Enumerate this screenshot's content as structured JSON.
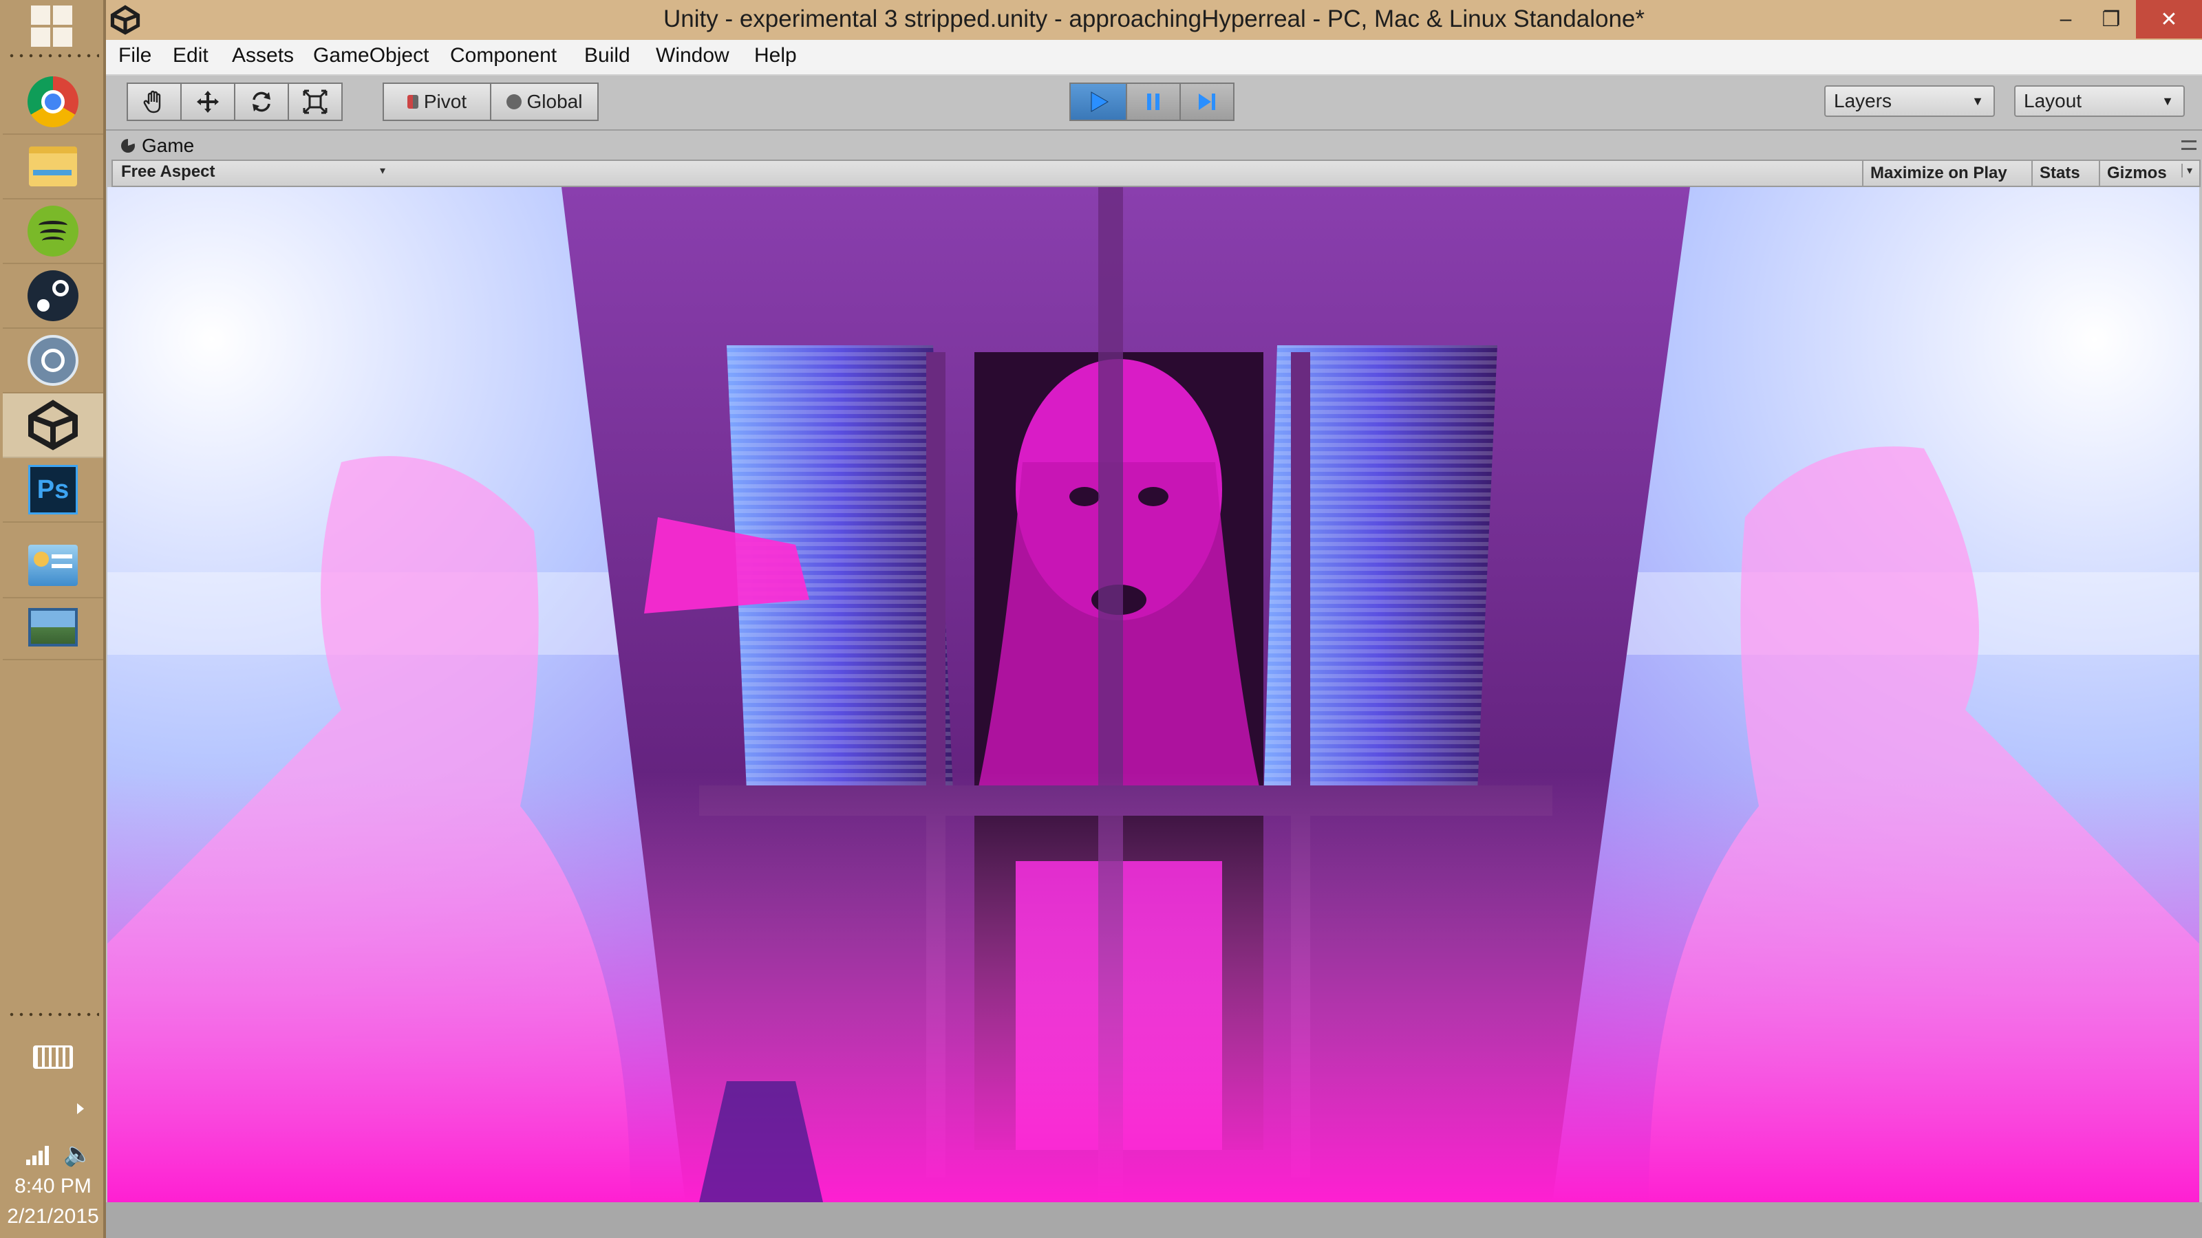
{
  "window": {
    "title": "Unity - experimental 3 stripped.unity - approachingHyperreal - PC, Mac & Linux Standalone*",
    "controls": {
      "minimize": "–",
      "restore": "❐",
      "close": "✕"
    }
  },
  "menu": {
    "items": [
      "File",
      "Edit",
      "Assets",
      "GameObject",
      "Component",
      "Build",
      "Window",
      "Help"
    ]
  },
  "toolbar": {
    "pivot_label": "Pivot",
    "global_label": "Global",
    "layers_label": "Layers",
    "layout_label": "Layout"
  },
  "game_panel": {
    "tab_label": "Game",
    "aspect_label": "Free Aspect",
    "maximize_label": "Maximize on Play",
    "stats_label": "Stats",
    "gizmos_label": "Gizmos"
  },
  "taskbar": {
    "apps": [
      {
        "icon": "chrome-icon"
      },
      {
        "icon": "file-explorer-icon"
      },
      {
        "icon": "spotify-icon"
      },
      {
        "icon": "steam-icon"
      },
      {
        "icon": "monodevelop-icon"
      },
      {
        "icon": "unity-icon"
      },
      {
        "icon": "photoshop-icon",
        "label": "Ps"
      },
      {
        "icon": "control-panel-icon"
      },
      {
        "icon": "photo-viewer-icon"
      }
    ],
    "time": "8:40 PM",
    "date": "2/21/2015"
  },
  "colors": {
    "taskbar_bg": "#b89a6e",
    "titlebar_bg": "#d6b68a",
    "play_active": "#3a78b8",
    "scene_magenta": "#ff2ad4"
  }
}
